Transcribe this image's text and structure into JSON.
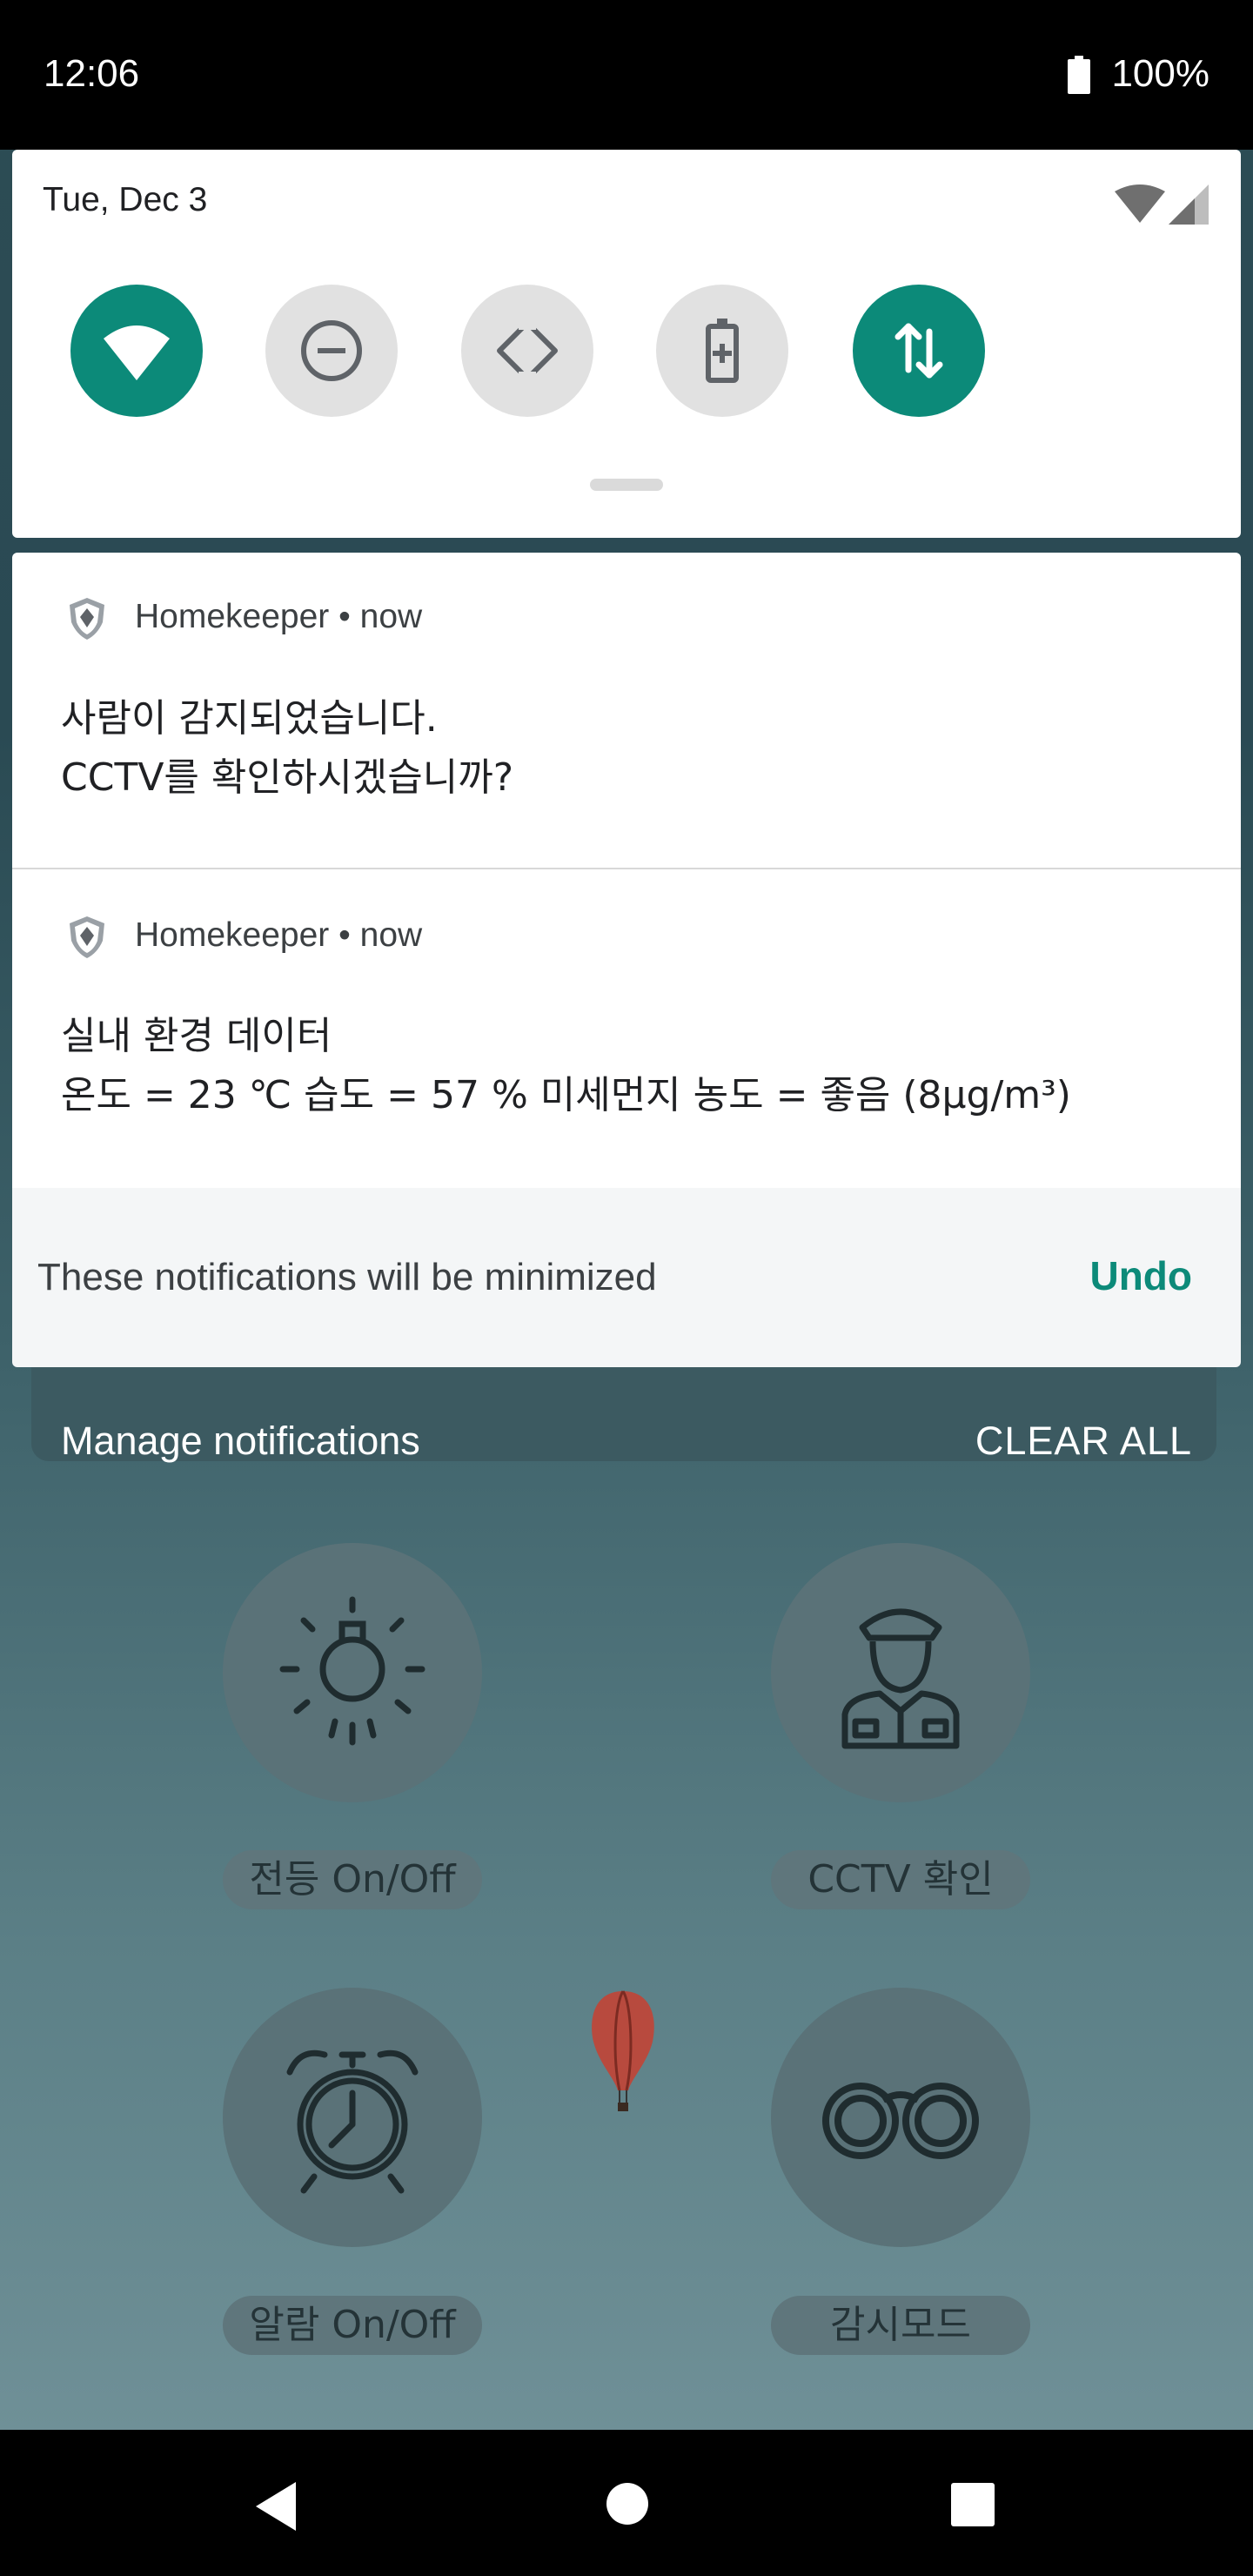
{
  "status_bar": {
    "time": "12:06",
    "battery": "100%"
  },
  "quick_settings": {
    "date": "Tue, Dec 3",
    "tiles": [
      {
        "icon": "wifi-icon",
        "state": "on"
      },
      {
        "icon": "do-not-disturb-icon",
        "state": "off"
      },
      {
        "icon": "auto-rotate-icon",
        "state": "off"
      },
      {
        "icon": "battery-saver-icon",
        "state": "off"
      },
      {
        "icon": "mobile-data-icon",
        "state": "on"
      }
    ],
    "accent_color": "#0c8a79"
  },
  "notifications": [
    {
      "app": "Homekeeper",
      "time": "now",
      "line1": "사람이 감지되었습니다.",
      "line2": "CCTV를 확인하시겠습니까?"
    },
    {
      "app": "Homekeeper",
      "time": "now",
      "line1": "실내 환경 데이터",
      "line2": "온도 = 23 ℃ 습도 = 57 % 미세먼지 농도 = 좋음 (8μg/m³)"
    }
  ],
  "minimize_bar": {
    "text": "These notifications will be minimized",
    "undo": "Undo"
  },
  "footer": {
    "manage": "Manage notifications",
    "clear_all": "CLEAR ALL"
  },
  "app_background": {
    "tiles": [
      {
        "label": "전등 On/Off",
        "icon": "light-bulb-icon"
      },
      {
        "label": "CCTV 확인",
        "icon": "guard-icon"
      },
      {
        "label": "알람 On/Off",
        "icon": "alarm-clock-icon"
      },
      {
        "label": "감시모드",
        "icon": "binoculars-icon"
      }
    ]
  }
}
